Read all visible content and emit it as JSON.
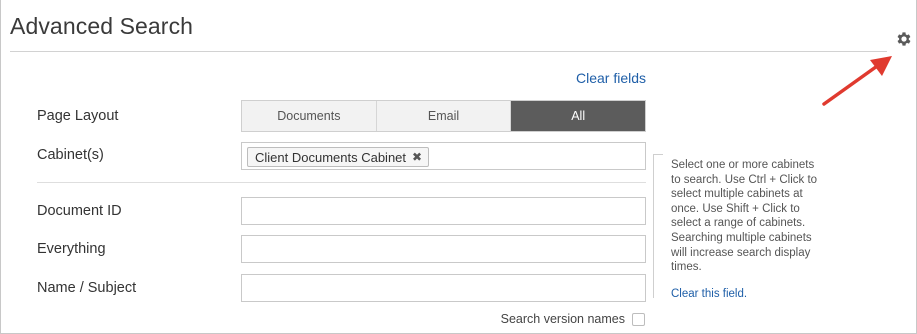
{
  "header": {
    "title": "Advanced Search",
    "settings_icon": "gear-icon"
  },
  "toolbar": {
    "clear_fields": "Clear fields"
  },
  "form": {
    "page_layout": {
      "label": "Page Layout",
      "options": [
        "Documents",
        "Email",
        "All"
      ],
      "selected": "All"
    },
    "cabinets": {
      "label": "Cabinet(s)",
      "selected": [
        "Client Documents Cabinet"
      ],
      "remove_glyph": "✖"
    },
    "document_id": {
      "label": "Document ID",
      "value": ""
    },
    "everything": {
      "label": "Everything",
      "value": ""
    },
    "name_subject": {
      "label": "Name / Subject",
      "value": ""
    },
    "search_version_names": {
      "label": "Search version names",
      "checked": false
    }
  },
  "help": {
    "lines": [
      "Select one or more cabinets",
      "to search. Use Ctrl + Click to",
      "select multiple cabinets at",
      "once. Use Shift + Click to",
      "select a range of cabinets.",
      "Searching multiple cabinets",
      "will increase search display",
      "times."
    ],
    "clear_field": "Clear this field."
  },
  "colors": {
    "accent_link": "#1f5fa8",
    "active_segment": "#5c5c5c",
    "annotation_arrow": "#e03a2f"
  }
}
